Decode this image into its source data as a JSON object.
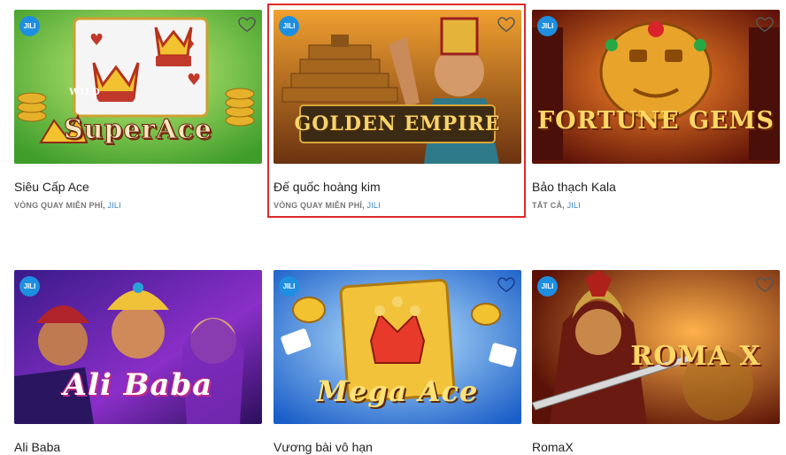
{
  "games": [
    {
      "name": "Siêu Cấp Ace",
      "category": "VÒNG QUAY MIỄN PHÍ,",
      "provider": "JILI",
      "badge": "JILI",
      "logo": "SuperAce",
      "tag": "WILD"
    },
    {
      "name": "Đế quốc hoàng kim",
      "category": "VÒNG QUAY MIỄN PHÍ,",
      "provider": "JILI",
      "badge": "JILI",
      "logo": "GOLDEN EMPIRE"
    },
    {
      "name": "Bảo thạch Kala",
      "category": "TẤT CẢ,",
      "provider": "JILI",
      "badge": "JILI",
      "logo": "FORTUNE GEMS"
    },
    {
      "name": "Ali Baba",
      "badge": "JILI",
      "logo": "Ali Baba"
    },
    {
      "name": "Vương bài vô hạn",
      "badge": "JILI",
      "logo": "Mega Ace"
    },
    {
      "name": "RomaX",
      "badge": "JILI",
      "logo": "ROMA X"
    }
  ],
  "selected_game": "Đế quốc hoàng kim",
  "colors": {
    "badge": "#1e8fe0",
    "highlight": "#e02b2b",
    "provider": "#3b82c4"
  }
}
